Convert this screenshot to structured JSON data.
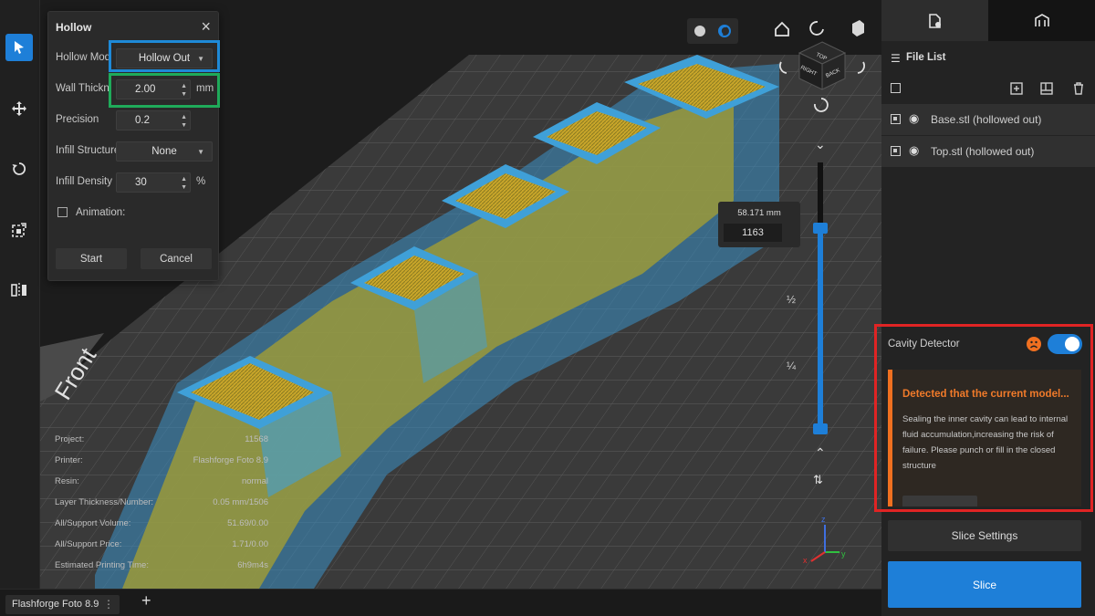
{
  "dialog": {
    "title": "Hollow",
    "hollow_mode_label": "Hollow Mod",
    "hollow_mode_value": "Hollow Out",
    "wall_thickness_label": "Wall Thickn...",
    "wall_thickness_value": "2.00",
    "wall_thickness_unit": "mm",
    "precision_label": "Precision",
    "precision_value": "0.2",
    "infill_structure_label": "Infill Structure",
    "infill_structure_value": "None",
    "infill_density_label": "Infill Density",
    "infill_density_value": "30",
    "infill_density_unit": "%",
    "animation_label": "Animation:",
    "start_label": "Start",
    "cancel_label": "Cancel"
  },
  "viewport": {
    "front_label": "Front",
    "cube_labels": [
      "TOP",
      "RIGHT",
      "BACK"
    ],
    "height_mm": "58.171 mm",
    "layer_number": "1163",
    "slider_marks": [
      "½",
      "¼"
    ],
    "slider_fill_fraction": 0.74,
    "axes": [
      "x",
      "y",
      "z"
    ]
  },
  "info": {
    "rows": [
      {
        "label": "Project:",
        "value": "11568"
      },
      {
        "label": "Printer:",
        "value": "Flashforge Foto 8.9"
      },
      {
        "label": "Resin:",
        "value": "normal"
      },
      {
        "label": "Layer Thickness/Number:",
        "value": "0.05 mm/1506"
      },
      {
        "label": "All/Support Volume:",
        "value": "51.69/0.00"
      },
      {
        "label": "All/Support Price:",
        "value": "1.71/0.00"
      },
      {
        "label": "Estimated Printing Time:",
        "value": "6h9m4s"
      }
    ]
  },
  "panel": {
    "file_list_title": "File List",
    "files": [
      {
        "name": "Base.stl (hollowed out)"
      },
      {
        "name": "Top.stl (hollowed out)"
      }
    ],
    "cavity_title": "Cavity Detector",
    "cavity_enabled": true,
    "warning_title": "Detected that the current model...",
    "warning_text": "Sealing the inner cavity can lead to internal fluid accumulation,increasing the risk of failure. Please punch or fill in the closed structure",
    "slice_settings_label": "Slice Settings",
    "slice_label": "Slice"
  },
  "tabbar": {
    "tab_label": "Flashforge Foto 8.9",
    "add_label": "+"
  },
  "colors": {
    "accent": "#1e7fd8",
    "model_yellow": "#b8b43a",
    "model_blue": "#3fa0d8",
    "warning_orange": "#f07020",
    "highlight_red": "#e02424",
    "highlight_blue": "#1e8ad8",
    "highlight_green": "#1faa5a"
  }
}
